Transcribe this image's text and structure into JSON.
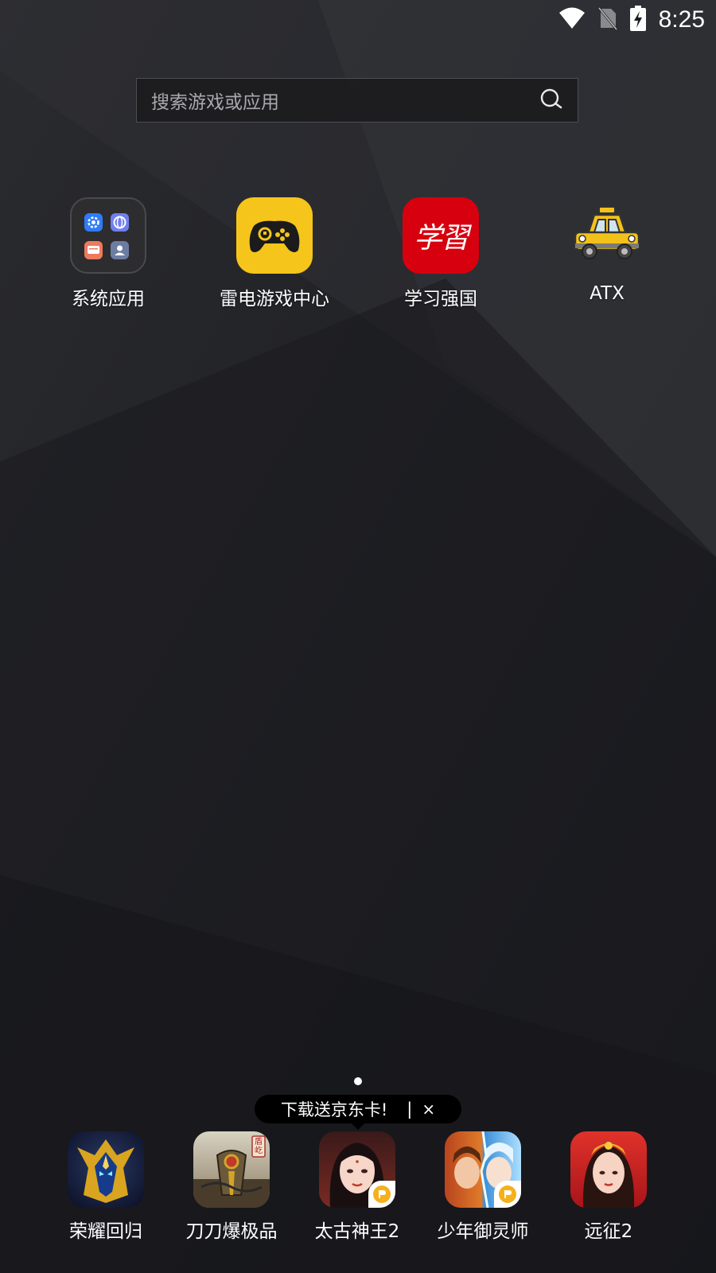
{
  "status_bar": {
    "time": "8:25"
  },
  "search": {
    "placeholder": "搜索游戏或应用"
  },
  "home_apps": [
    {
      "label": "系统应用"
    },
    {
      "label": "雷电游戏中心"
    },
    {
      "label": "学习强国",
      "icon_text": "学習"
    },
    {
      "label": "ATX"
    }
  ],
  "promo": {
    "text": "下载送京东卡!",
    "separator": "|",
    "close": "×"
  },
  "dock_apps": [
    {
      "label": "荣耀回归"
    },
    {
      "label": "刀刀爆极品",
      "icon_text": "盾屹"
    },
    {
      "label": "太古神王2"
    },
    {
      "label": "少年御灵师"
    },
    {
      "label": "远征2"
    }
  ],
  "colors": {
    "wallpaper": "#1c1d21",
    "leidian_yellow": "#f5c51b",
    "xuexi_red": "#d7000f",
    "taxi_yellow": "#f3c21a"
  }
}
